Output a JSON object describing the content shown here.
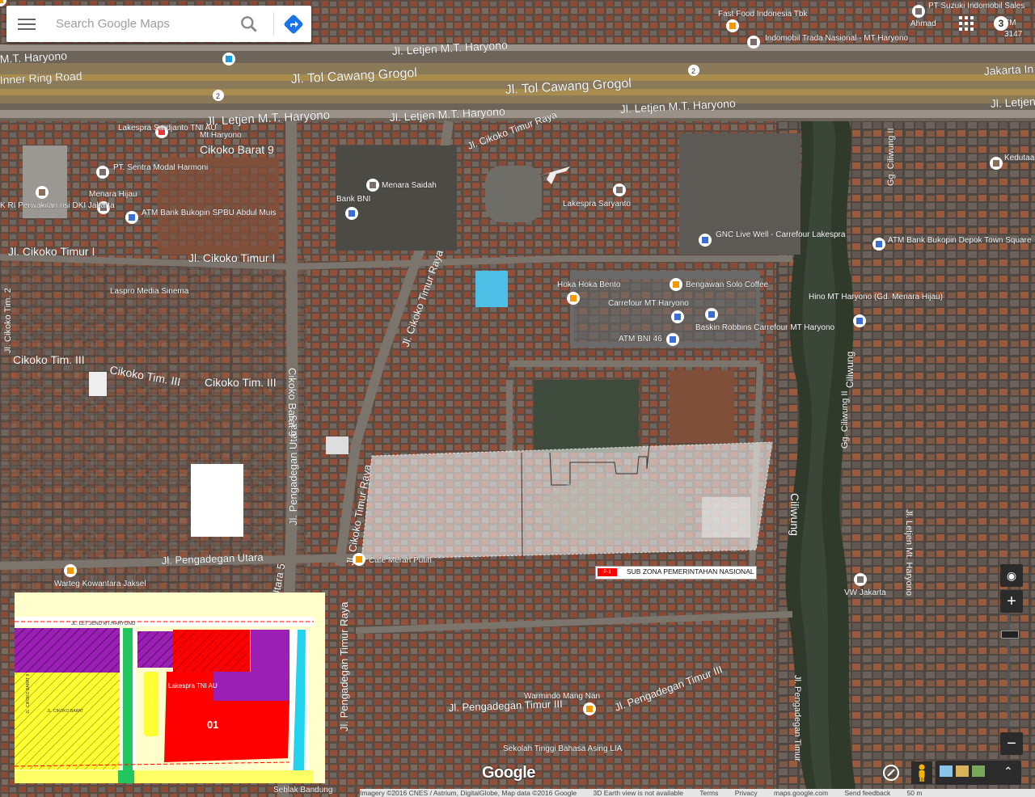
{
  "search": {
    "placeholder": "Search Google Maps"
  },
  "road_labels": [
    {
      "text": "Jl. Letjen M.T. Haryono"
    },
    {
      "text": "Jl. Tol Cawang Grogol"
    },
    {
      "text": "Jl. Tol Cawang Grogol"
    },
    {
      "text": "Jl. Letjen M.T. Haryono"
    },
    {
      "text": "Jl. Letjen M.T. Haryono"
    },
    {
      "text": "Jl. Letjen M.T. Haryono"
    },
    {
      "text": "Jl. Cikoko Timur Raya"
    },
    {
      "text": "Cikoko Barat 9"
    },
    {
      "text": "Jl. Cikoko Timur I"
    },
    {
      "text": "Jl. Cikoko Timur I"
    },
    {
      "text": "Cikoko Tim. III"
    },
    {
      "text": "Cikoko Tim. III"
    },
    {
      "text": "Cikoko Tim. III"
    },
    {
      "text": "Jl. Cikoko Timur Raya"
    },
    {
      "text": "Jl. Pengadegan Utara 5"
    },
    {
      "text": "Cikoko Barat 9"
    },
    {
      "text": "Jl. Pengadegan Utara"
    },
    {
      "text": "Jl. Cikoko Timur Raya"
    },
    {
      "text": "Jl. Pengadegan Timur Raya"
    },
    {
      "text": "Jl. Pengadegan Timur III"
    },
    {
      "text": "Jl. Pengadegan Timur III"
    },
    {
      "text": "Ciliwung"
    },
    {
      "text": "Ciliwung"
    },
    {
      "text": "Gg. Ciliwung II"
    },
    {
      "text": "Gg. Ciliwung II"
    },
    {
      "text": "Jl. Letjen Mt. Haryono"
    },
    {
      "text": "Jl. Pengadegan Timur"
    },
    {
      "text": "Inner Ring Road"
    },
    {
      "text": "M.T. Haryono"
    },
    {
      "text": "Jakarta In"
    },
    {
      "text": "Jl. Letjen"
    },
    {
      "text": "Jl. Cikoko Tim. 2"
    },
    {
      "text": "Utara 5"
    }
  ],
  "pois": [
    {
      "name": "Fast Food Indonesia Tbk",
      "icon": "restaurant-icon"
    },
    {
      "name": "PT Suzuki Indomobil Sales",
      "icon": "building-icon"
    },
    {
      "name": "Indomobil Trada Nasional - MT Haryono",
      "icon": "building-icon"
    },
    {
      "name": "Lakespra Sardjanto TNI AU",
      "icon": "hospital-icon"
    },
    {
      "name": "Mt Haryono",
      "icon": "transit-icon"
    },
    {
      "name": "PT. Sentra Modal Harmoni",
      "icon": "building-icon"
    },
    {
      "name": "Menara Hijau",
      "icon": "building-icon"
    },
    {
      "name": "ATM Bank Bukopin SPBU Abdul Muis",
      "icon": "atm-icon"
    },
    {
      "name": "K RI Perwakilan nsi DKI Jakarta",
      "icon": "government-icon"
    },
    {
      "name": "Menara Saidah",
      "icon": "building-icon"
    },
    {
      "name": "Bank BNI",
      "icon": "bank-icon"
    },
    {
      "name": "Lakespra Saryanto",
      "icon": "building-icon"
    },
    {
      "name": "GNC Live Well - Carrefour Lakespra",
      "icon": "shopping-icon"
    },
    {
      "name": "Kedutaa Arab Sa",
      "icon": "government-icon"
    },
    {
      "name": "ATM Bank Bukopin Depok Town Square",
      "icon": "atm-icon"
    },
    {
      "name": "Laspro Media Sinema",
      "icon": "building-icon"
    },
    {
      "name": "Hoka Hoka Bento",
      "icon": "restaurant-icon"
    },
    {
      "name": "Bengawan Solo Coffee",
      "icon": "restaurant-icon"
    },
    {
      "name": "Carrefour MT Haryono",
      "icon": "shopping-icon"
    },
    {
      "name": "Baskin Robbins Carrefour MT Haryono",
      "icon": "shopping-icon"
    },
    {
      "name": "ATM BNI 46",
      "icon": "atm-icon"
    },
    {
      "name": "Hino MT Haryono (Gd. Menara Hijau)",
      "icon": "shopping-icon"
    },
    {
      "name": "Cafe Merah Putih",
      "icon": "cafe-icon"
    },
    {
      "name": "Warteg Kowantara Jaksel",
      "icon": "restaurant-icon"
    },
    {
      "name": "VW Jakarta",
      "icon": "building-icon"
    },
    {
      "name": "Warmindo Mang Nan",
      "icon": "cafe-icon"
    },
    {
      "name": "Sekolah Tinggi Bahasa Asing LIA",
      "icon": "school-icon"
    },
    {
      "name": "Seblak Bandung",
      "icon": "restaurant-icon"
    },
    {
      "name": "Ahmad",
      "icon": ""
    },
    {
      "name": "3147",
      "icon": ""
    },
    {
      "name": "TM",
      "icon": ""
    }
  ],
  "highway_shields": [
    "2",
    "2"
  ],
  "overlay_legend": {
    "code": "P-1",
    "label": "SUB ZONA PEMERINTAHAN NASIONAL",
    "color": "#ff0000"
  },
  "inset_map": {
    "road_label": "JL. LET JEND MT.HARYONO",
    "main_label": "Lakespra TNI AU",
    "zone_number": "01",
    "side_label_1": "JL. CIKOKO BARAT 9",
    "side_label_2": "JL. CIKOKO BARAT",
    "colors": {
      "yellow": "#ffff33",
      "purple": "#9b1fb5",
      "red": "#ff0000",
      "green": "#22c55e",
      "cyan": "#22d3ee"
    }
  },
  "account": {
    "notifications": "3"
  },
  "map_controls": {
    "zoom_in": "+",
    "zoom_out": "−"
  },
  "footer": {
    "imagery": "Imagery ©2016 CNES / Astrium, DigitalGlobe, Map data ©2016 Google",
    "earth_note": "3D Earth view is not available",
    "terms": "Terms",
    "privacy": "Privacy",
    "domain": "maps.google.com",
    "feedback": "Send feedback",
    "scale": "50 m"
  },
  "google_logo": "Google"
}
